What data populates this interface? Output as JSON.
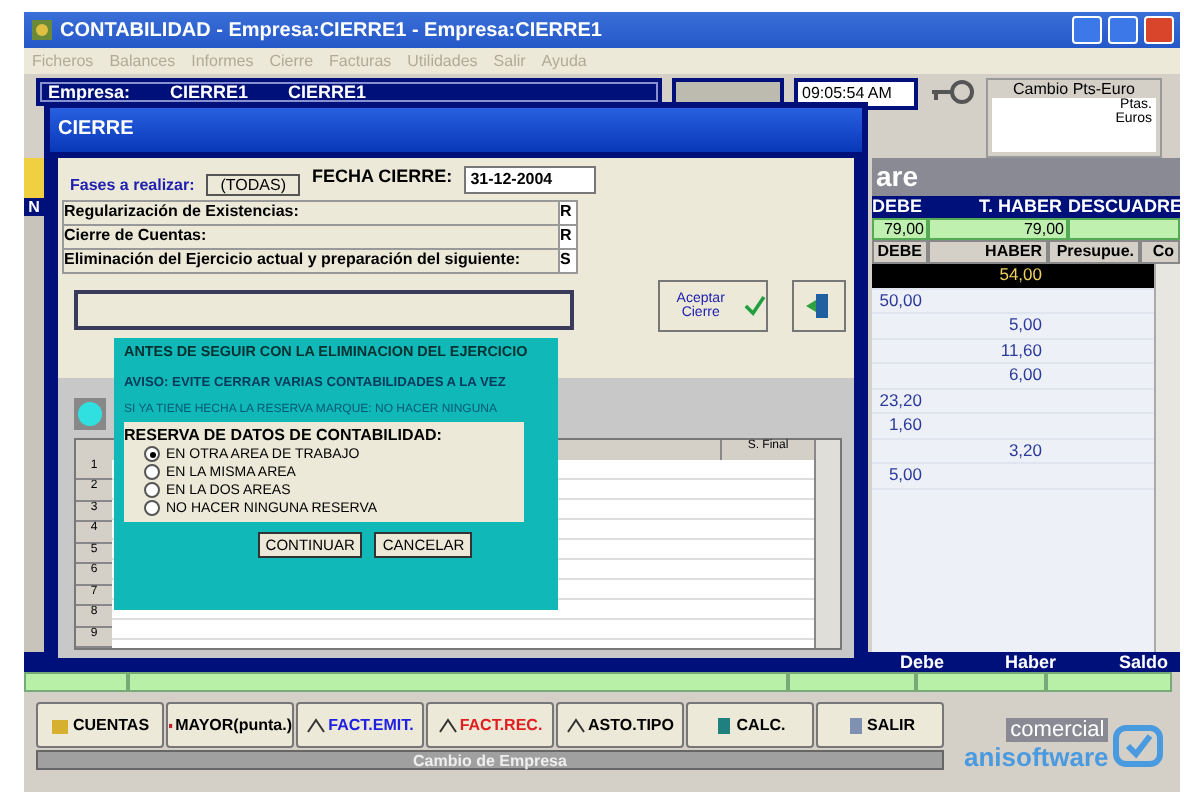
{
  "window": {
    "title": "CONTABILIDAD - Empresa:CIERRE1 - Empresa:CIERRE1"
  },
  "menu": [
    {
      "label": "Ficheros",
      "disabled": true
    },
    {
      "label": "Balances",
      "disabled": true
    },
    {
      "label": "Informes",
      "disabled": true
    },
    {
      "label": "Cierre",
      "disabled": true
    },
    {
      "label": "Facturas",
      "disabled": true
    },
    {
      "label": "Utilidades",
      "disabled": true
    },
    {
      "label": "Salir",
      "disabled": true
    },
    {
      "label": "Ayuda",
      "disabled": true
    }
  ],
  "company_bar": {
    "label": "Empresa:",
    "code": "CIERRE1",
    "name": "CIERRE1"
  },
  "time": "09:05:54 AM",
  "currency_box": {
    "title": "Cambio Pts-Euro",
    "units": [
      "Ptas.",
      "Euros"
    ]
  },
  "side_marker": "N",
  "logo_fragment": "are",
  "totals": {
    "columns": [
      "DEBE",
      "T. HABER",
      "DESCUADRE"
    ],
    "debe": "79,00",
    "haber": "79,00"
  },
  "ledger": {
    "columns": [
      "DEBE",
      "HABER",
      "Presupue.",
      "Co"
    ],
    "rows": [
      {
        "haber": "54,00",
        "selected": true
      },
      {
        "debe": "50,00",
        "selected": false
      },
      {
        "haber": "5,00",
        "selected": false
      },
      {
        "haber": "11,60",
        "selected": false
      },
      {
        "haber": "6,00",
        "selected": false
      },
      {
        "debe": "23,20",
        "selected": false
      },
      {
        "debe": "1,60",
        "selected": false
      },
      {
        "haber": "3,20",
        "selected": false
      },
      {
        "debe": "5,00",
        "selected": false
      }
    ]
  },
  "footer_table": {
    "columns": [
      "Debe",
      "Haber",
      "Saldo"
    ]
  },
  "toolbar": [
    {
      "label": "CUENTAS",
      "color": "#000000"
    },
    {
      "label": "MAYOR(punta.)",
      "color": "#000000"
    },
    {
      "label": "FACT.EMIT.",
      "color": "#2020e0"
    },
    {
      "label": "FACT.REC.",
      "color": "#e02020"
    },
    {
      "label": "ASTO.TIPO",
      "color": "#000000"
    },
    {
      "label": "CALC.",
      "color": "#000000"
    },
    {
      "label": "SALIR",
      "color": "#000000"
    }
  ],
  "company_button": "Cambio de Empresa",
  "logo": {
    "top": "comercial",
    "bottom": "anisoftware"
  },
  "cierre_dialog": {
    "title": "CIERRE",
    "phases_label": "Fases a realizar:",
    "phases_button": "(TODAS)",
    "date_label": "FECHA CIERRE:",
    "date_value": "31-12-2004",
    "steps": [
      {
        "label": "Regularización de Existencias:",
        "value": "R"
      },
      {
        "label": "Cierre de Cuentas:",
        "value": "R"
      },
      {
        "label": "Eliminación del Ejercicio actual y preparación del siguiente:",
        "value": "S"
      }
    ],
    "accept_button": "Aceptar Cierre",
    "grid": {
      "row_numbers": [
        "1",
        "2",
        "3",
        "4",
        "5",
        "6",
        "7",
        "8",
        "9"
      ],
      "column": "S. Final"
    }
  },
  "warning_dialog": {
    "title": "ANTES DE SEGUIR CON LA ELIMINACION DEL EJERCICIO",
    "warning": "AVISO: EVITE CERRAR VARIAS CONTABILIDADES A LA VEZ",
    "hint": "SI YA TIENE HECHA LA RESERVA MARQUE: NO HACER NINGUNA",
    "group_title": "RESERVA DE DATOS DE CONTABILIDAD:",
    "options": [
      {
        "label": "EN OTRA AREA DE TRABAJO",
        "selected": true
      },
      {
        "label": "EN LA MISMA AREA",
        "selected": false
      },
      {
        "label": "EN LA DOS AREAS",
        "selected": false
      },
      {
        "label": "NO HACER NINGUNA RESERVA",
        "selected": false
      }
    ],
    "buttons": [
      "CONTINUAR",
      "CANCELAR"
    ]
  }
}
